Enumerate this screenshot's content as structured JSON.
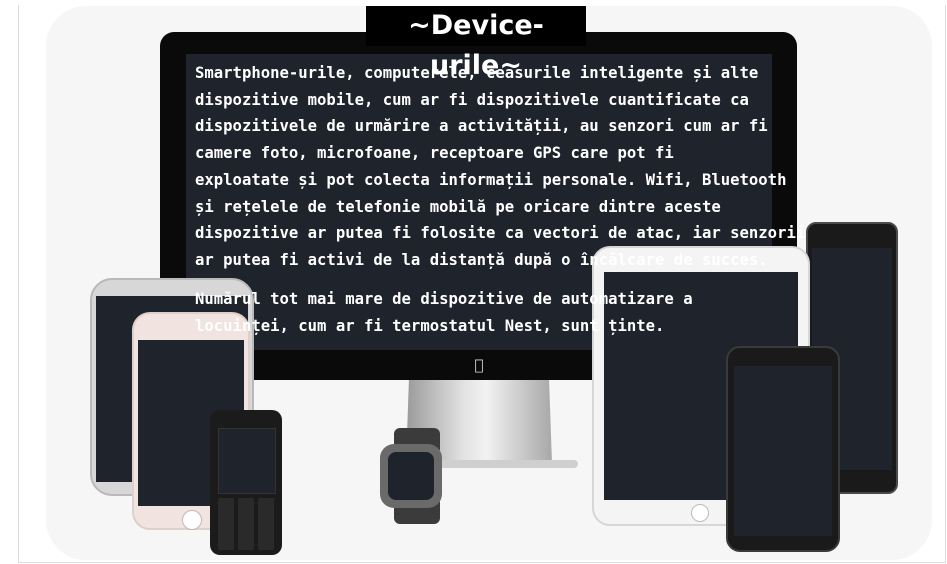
{
  "slide": {
    "title": "~Device-urile~",
    "paragraph1": [
      "Smartphone-urile, computerele, ceasurile inteligente și alte",
      "dispozitive mobile, cum ar fi dispozitivele cuantificate ca",
      "dispozitivele de urmărire a activității, au senzori cum ar fi",
      "camere foto, microfoane, receptoare GPS care pot fi",
      "exploatate și pot colecta informații personale. Wifi, Bluetooth",
      "și rețelele de telefonie mobilă pe oricare dintre aceste",
      "dispozitive ar putea fi folosite ca vectori de atac, iar senzorii",
      "ar putea fi activi de la distanță după o încălcare de succes."
    ],
    "paragraph2": [
      "Numărul tot mai mare de dispozitive de automatizare a",
      "locuinței, cum ar fi termostatul Nest, sunt ținte."
    ]
  },
  "icons": {
    "apple_logo": "apple-logo-icon"
  },
  "colors": {
    "screen": "#1f242c",
    "bezel": "#0a0a0a",
    "title_bg": "#000000",
    "text": "#ffffff"
  }
}
